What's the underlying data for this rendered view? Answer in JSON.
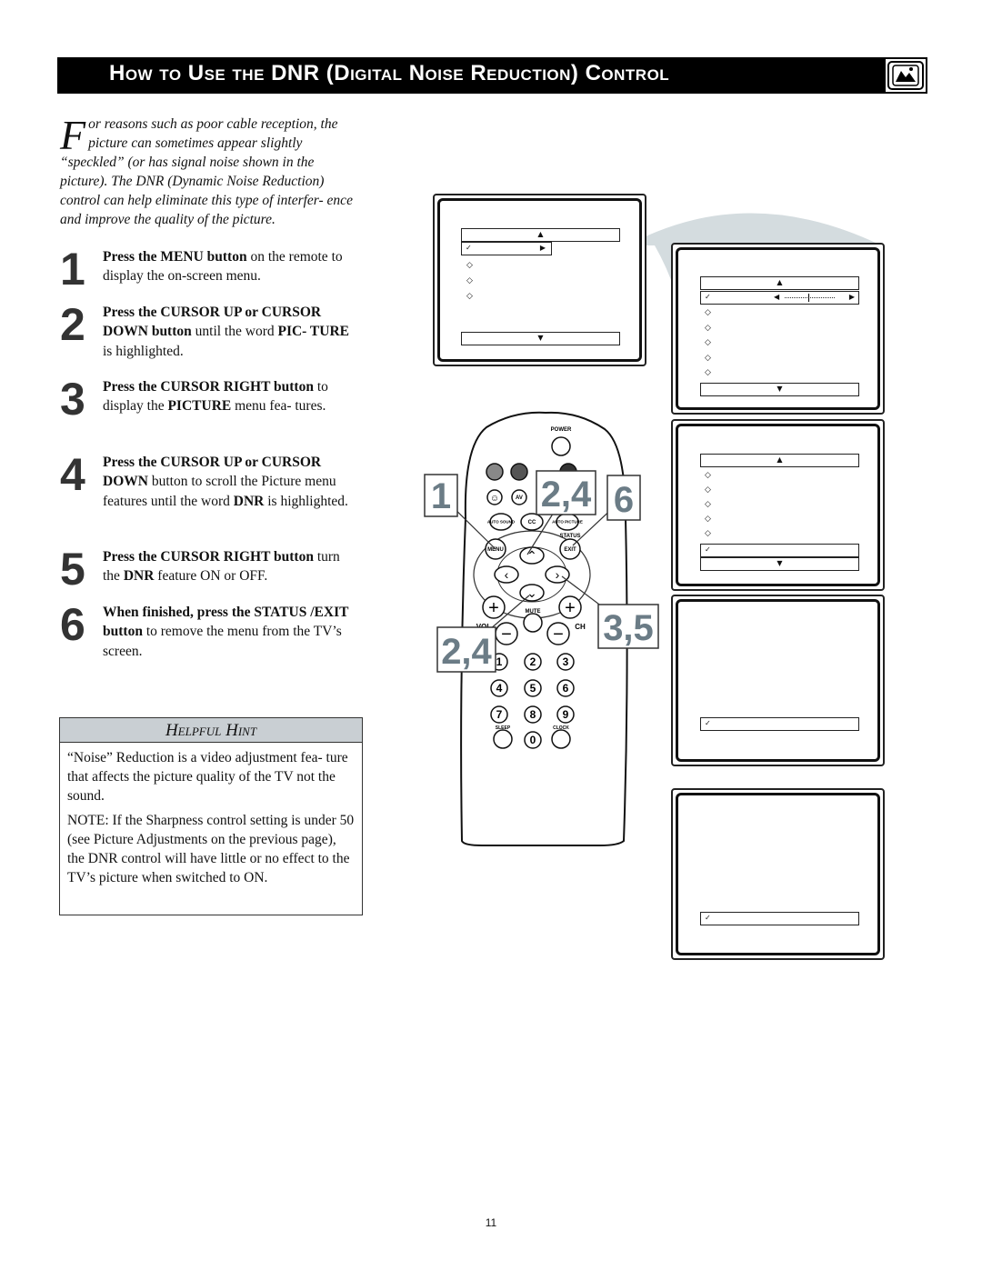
{
  "header": {
    "title": "How to Use the DNR (Digital Noise Reduction) Control",
    "icon": "tv-picture-icon",
    "bg": "#000000"
  },
  "intro": {
    "dropcap": "F",
    "text": "or reasons such as poor cable reception, the picture can sometimes appear slightly “speckled” (or has signal noise shown in the picture). The DNR (Dynamic Noise Reduction) control can help eliminate this type of interfer- ence and improve the quality of the picture."
  },
  "steps": [
    {
      "num": "1",
      "parts": [
        {
          "b": true,
          "t": "Press the MENU button"
        },
        {
          "b": false,
          "t": " on the remote to display the on-screen menu."
        }
      ]
    },
    {
      "num": "2",
      "parts": [
        {
          "b": true,
          "t": "Press the CURSOR UP or  CURSOR DOWN button"
        },
        {
          "b": false,
          "t": " until the word "
        },
        {
          "b": true,
          "t": "PIC- TURE"
        },
        {
          "b": false,
          "t": " is highlighted."
        }
      ]
    },
    {
      "num": "3",
      "parts": [
        {
          "b": true,
          "t": "Press the CURSOR RIGHT button"
        },
        {
          "b": false,
          "t": " to display the "
        },
        {
          "b": true,
          "t": "PICTURE"
        },
        {
          "b": false,
          "t": " menu fea- tures."
        }
      ]
    },
    {
      "num": "4",
      "parts": [
        {
          "b": true,
          "t": "Press the CURSOR UP or  CURSOR DOWN"
        },
        {
          "b": false,
          "t": " button to scroll the Picture menu features until the word "
        },
        {
          "b": true,
          "t": "DNR"
        },
        {
          "b": false,
          "t": " is highlighted."
        }
      ]
    },
    {
      "num": "5",
      "parts": [
        {
          "b": true,
          "t": "Press the CURSOR RIGHT button"
        },
        {
          "b": false,
          "t": " turn the "
        },
        {
          "b": true,
          "t": "DNR"
        },
        {
          "b": false,
          "t": " feature ON or OFF."
        }
      ]
    },
    {
      "num": "6",
      "parts": [
        {
          "b": true,
          "t": "When finished, press the STATUS /EXIT button"
        },
        {
          "b": false,
          "t": " to remove the menu from the TV’s screen."
        }
      ]
    }
  ],
  "hint": {
    "title": "Helpful Hint",
    "paragraphs": [
      "“Noise” Reduction is a video adjustment fea- ture that affects the picture quality of the TV not the sound.",
      "NOTE: If the Sharpness control setting is under 50 (see Picture Adjustments on the previous page), the DNR control will have little or no effect to the TV’s picture when switched to ON."
    ]
  },
  "remote": {
    "labels": {
      "power": "POWER",
      "av": "AV",
      "auto_sound": "AUTO SOUND",
      "cc": "CC",
      "auto_picture": "AUTO PICTURE",
      "status": "STATUS",
      "menu": "MENU",
      "exit": "EXIT",
      "mute": "MUTE",
      "vol": "VOL",
      "ch": "CH",
      "sleep": "SLEEP",
      "clock": "CLOCK"
    },
    "digits": [
      "1",
      "2",
      "3",
      "4",
      "5",
      "6",
      "7",
      "8",
      "9",
      "0"
    ],
    "callouts": {
      "menu": "1",
      "up": "2,4",
      "exit": "6",
      "right": "3,5",
      "down": "2,4"
    },
    "callout_color": "#6b7c86"
  },
  "page_number": "11"
}
